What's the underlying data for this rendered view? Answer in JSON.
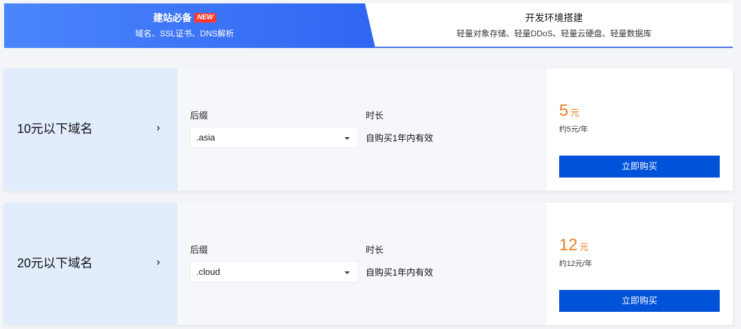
{
  "tabs": [
    {
      "title": "建站必备",
      "badge": "NEW",
      "subtitle": "域名、SSL证书、DNS解析",
      "active": true
    },
    {
      "title": "开发环境搭建",
      "subtitle": "轻量对象存储、轻量DDoS、轻量云硬盘、轻量数据库",
      "active": false
    }
  ],
  "products": [
    {
      "name": "10元以下域名",
      "suffix_label": "后缀",
      "suffix_value": ".asia",
      "duration_label": "时长",
      "duration_value": "自购买1年内有效",
      "price": "5",
      "price_unit": "元",
      "price_note": "约5元/年",
      "buy_label": "立即购买"
    },
    {
      "name": "20元以下域名",
      "suffix_label": "后缀",
      "suffix_value": ".cloud",
      "duration_label": "时长",
      "duration_value": "自购买1年内有效",
      "price": "12",
      "price_unit": "元",
      "price_note": "约12元/年",
      "buy_label": "立即购买"
    }
  ],
  "icons": {
    "expand": "chevron-right-icon",
    "dropdown": "caret-down-icon"
  },
  "colors": {
    "accent": "#2f66f2",
    "price": "#ee7a1c",
    "button": "#0052d9",
    "badge": "#ff3b2f"
  }
}
